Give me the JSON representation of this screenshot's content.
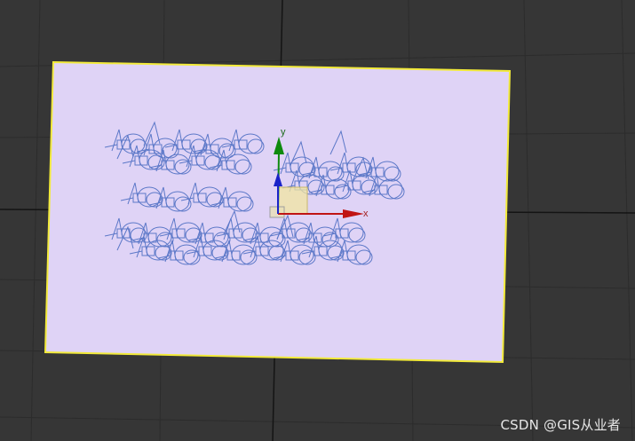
{
  "viewport": {
    "background_color": "#363636",
    "grid_color": "#2a2a2a",
    "grid_major_color": "#111111"
  },
  "plane": {
    "fill_color": "#dfd3f6",
    "selection_border_color": "#f2ea3a"
  },
  "model": {
    "wire_color": "#5c78c8"
  },
  "gizmo": {
    "y_axis_label": "y",
    "x_axis_label": "x",
    "y_color": "#0e8a0e",
    "x_color": "#c01414",
    "z_color": "#1a23c8",
    "plane_handle_color": "#f2e6a0"
  },
  "watermark": {
    "text": "CSDN @GIS从业者"
  }
}
